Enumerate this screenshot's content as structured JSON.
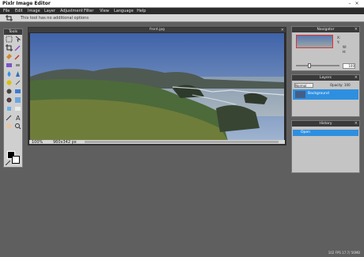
{
  "app": {
    "title": "Pixlr Image Editor"
  },
  "menu": [
    "File",
    "Edit",
    "Image",
    "Layer",
    "Adjustment",
    "Filter",
    "View",
    "Language",
    "Help"
  ],
  "options": {
    "text": "This tool has no additional options"
  },
  "tools_panel": {
    "title": "Tools"
  },
  "document": {
    "title": "front.jpg",
    "zoom": "100%",
    "size": "960x342 px"
  },
  "navigator": {
    "title": "Navigator",
    "x_label": "X:",
    "y_label": "Y:",
    "w_label": "W:",
    "h_label": "H:",
    "zoom": "100"
  },
  "layers": {
    "title": "Layers",
    "blend_mode": "Normal",
    "opacity_label": "Opacity:",
    "opacity_value": "100",
    "layer_name": "Background"
  },
  "history": {
    "title": "History",
    "items": [
      "Open"
    ]
  },
  "footer": {
    "fps": "102 FPS 17.7/ 56MB"
  },
  "colors": {
    "accent": "#2e8fe0",
    "panel": "#c4c4c4",
    "workspace": "#5f5f5f"
  }
}
